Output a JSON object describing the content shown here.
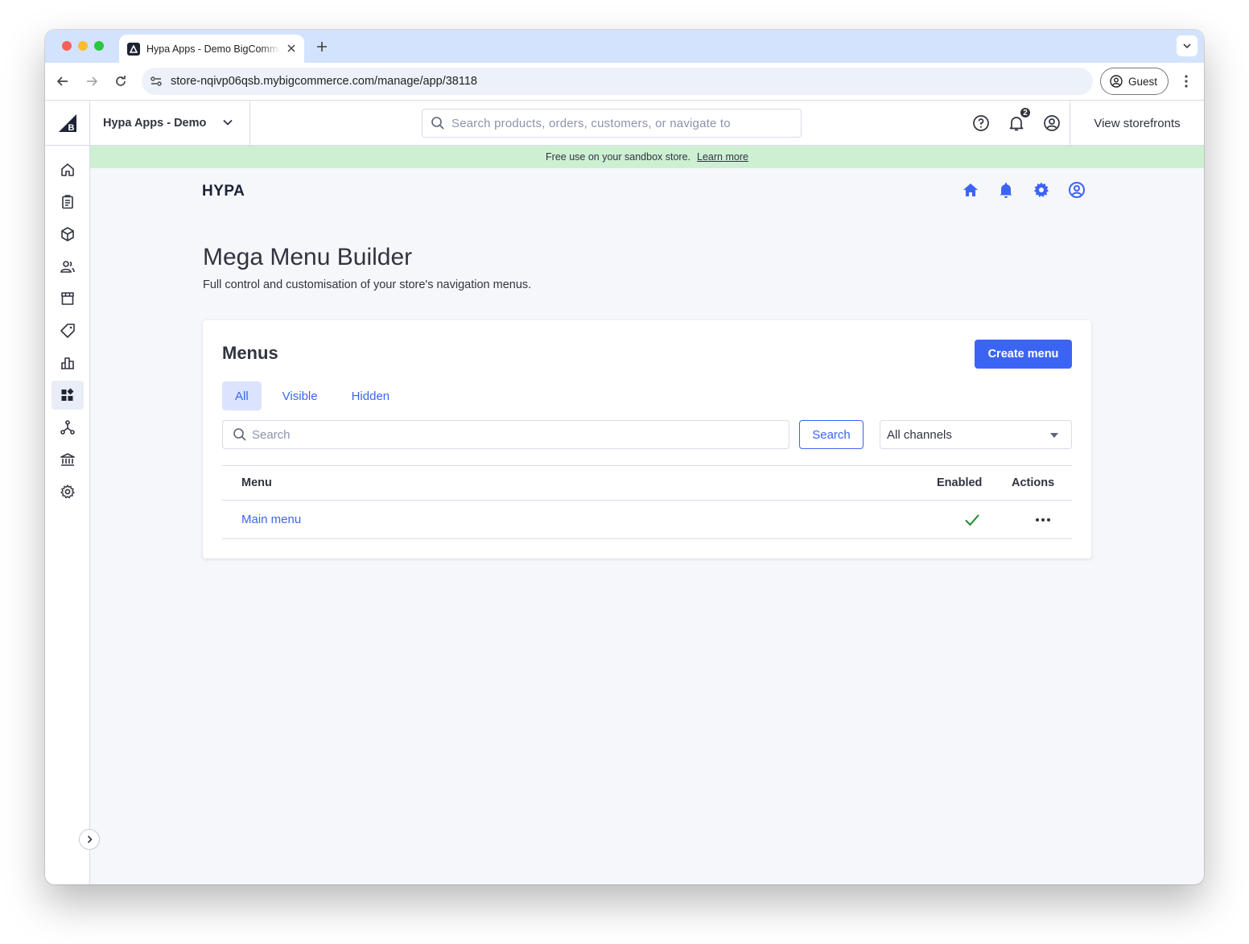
{
  "browser": {
    "tab_title": "Hypa Apps - Demo BigCommerce",
    "url": "store-nqivp06qsb.mybigcommerce.com/manage/app/38118",
    "profile_label": "Guest"
  },
  "header": {
    "store_name": "Hypa Apps - Demo",
    "search_placeholder": "Search products, orders, customers, or navigate to",
    "notification_count": "2",
    "view_storefronts": "View storefronts"
  },
  "banner": {
    "text": "Free use on your sandbox store.",
    "link": "Learn more"
  },
  "app": {
    "logo": "HYPA",
    "page_title": "Mega Menu Builder",
    "page_description": "Full control and customisation of your store's navigation menus."
  },
  "card": {
    "title": "Menus",
    "create_button": "Create menu",
    "tabs": [
      "All",
      "Visible",
      "Hidden"
    ],
    "active_tab": "All",
    "search_placeholder": "Search",
    "search_button": "Search",
    "channel_selected": "All channels",
    "columns": {
      "menu": "Menu",
      "enabled": "Enabled",
      "actions": "Actions"
    },
    "rows": [
      {
        "name": "Main menu",
        "enabled": true
      }
    ]
  },
  "colors": {
    "accent": "#3c64f4",
    "banner_bg": "#cdf0d3",
    "success": "#208831",
    "text": "#313440"
  }
}
